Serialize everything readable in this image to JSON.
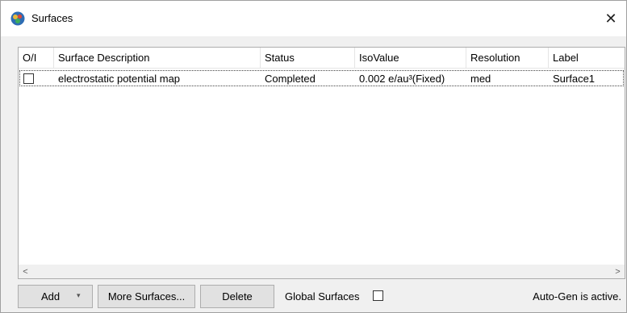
{
  "window": {
    "title": "Surfaces",
    "close_label": "✕"
  },
  "table": {
    "columns": [
      {
        "label": "O/I"
      },
      {
        "label": "Surface Description"
      },
      {
        "label": "Status"
      },
      {
        "label": "IsoValue"
      },
      {
        "label": "Resolution"
      },
      {
        "label": "Label"
      }
    ],
    "rows": [
      {
        "checked": false,
        "description": "electrostatic potential map",
        "status": "Completed",
        "isovalue": "0.002 e/au³(Fixed)",
        "resolution": "med",
        "label": "Surface1"
      }
    ]
  },
  "scrollbar": {
    "left_arrow": "<",
    "right_arrow": ">"
  },
  "buttons": {
    "add": "Add",
    "add_arrow": "▾",
    "more_surfaces": "More Surfaces...",
    "delete": "Delete"
  },
  "global_surfaces": {
    "label": "Global Surfaces",
    "checked": false
  },
  "status_text": "Auto-Gen is active."
}
